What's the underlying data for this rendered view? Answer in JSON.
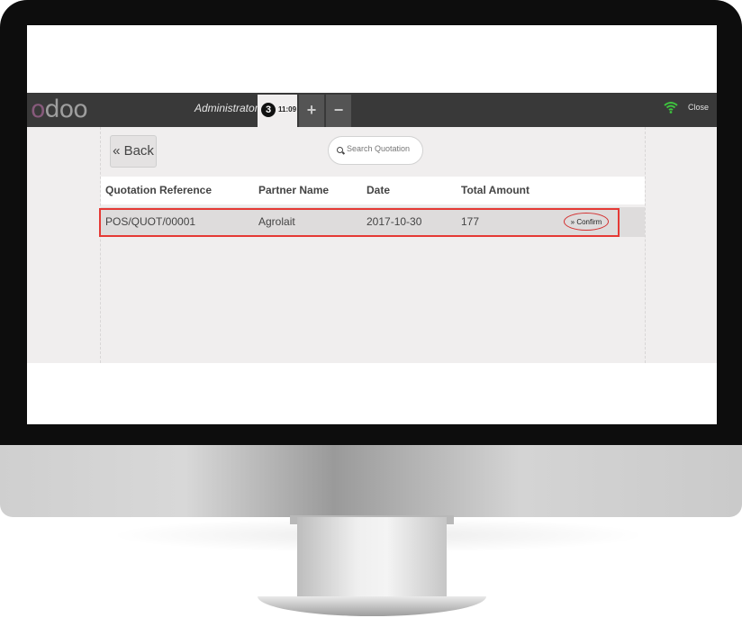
{
  "app": {
    "logo_text": "odoo",
    "cashier": "Administrator",
    "order_tab": {
      "number": "3",
      "time": "11:09"
    },
    "add_tab_label": "+",
    "remove_tab_label": "−",
    "close_label": "Close",
    "wifi_icon": "wifi-icon"
  },
  "screen": {
    "back_label": "« Back",
    "search_placeholder": "Search Quotation",
    "columns": [
      "Quotation Reference",
      "Partner Name",
      "Date",
      "Total Amount"
    ],
    "rows": [
      {
        "reference": "POS/QUOT/00001",
        "partner": "Agrolait",
        "date": "2017-10-30",
        "total": "177",
        "action": "» Confirm"
      }
    ]
  },
  "colors": {
    "brand_purple": "#875a7b",
    "topbar": "#393939",
    "highlight": "#e53935",
    "wifi_green": "#3ec43e"
  }
}
